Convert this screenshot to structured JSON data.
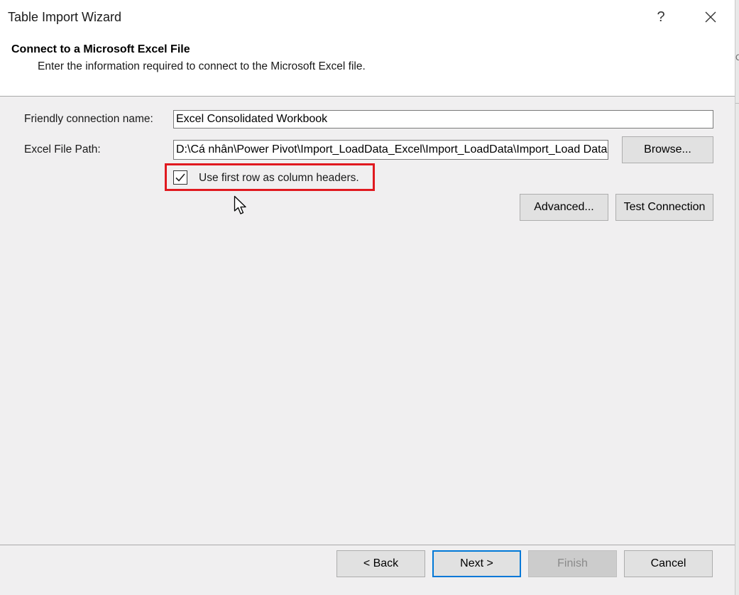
{
  "window": {
    "title": "Table Import Wizard",
    "help_label": "?",
    "close_icon": "close-icon"
  },
  "header": {
    "title": "Connect to a Microsoft Excel File",
    "subtitle": "Enter the information required to connect to the Microsoft Excel file."
  },
  "form": {
    "friendly_name_label": "Friendly connection name:",
    "friendly_name_value": "Excel Consolidated Workbook",
    "file_path_label": "Excel File Path:",
    "file_path_value": "D:\\Cá nhân\\Power Pivot\\Import_LoadData_Excel\\Import_LoadData\\Import_Load Data",
    "browse_label": "Browse...",
    "first_row_label": "Use first row as column headers.",
    "first_row_checked": true,
    "advanced_label": "Advanced...",
    "test_connection_label": "Test Connection"
  },
  "footer": {
    "back_label": "< Back",
    "next_label": "Next >",
    "finish_label": "Finish",
    "cancel_label": "Cancel"
  },
  "colors": {
    "highlight_border": "#e0191f",
    "default_button_border": "#0078d7",
    "dialog_background": "#f0eff0"
  },
  "background_fragment": "Ca"
}
